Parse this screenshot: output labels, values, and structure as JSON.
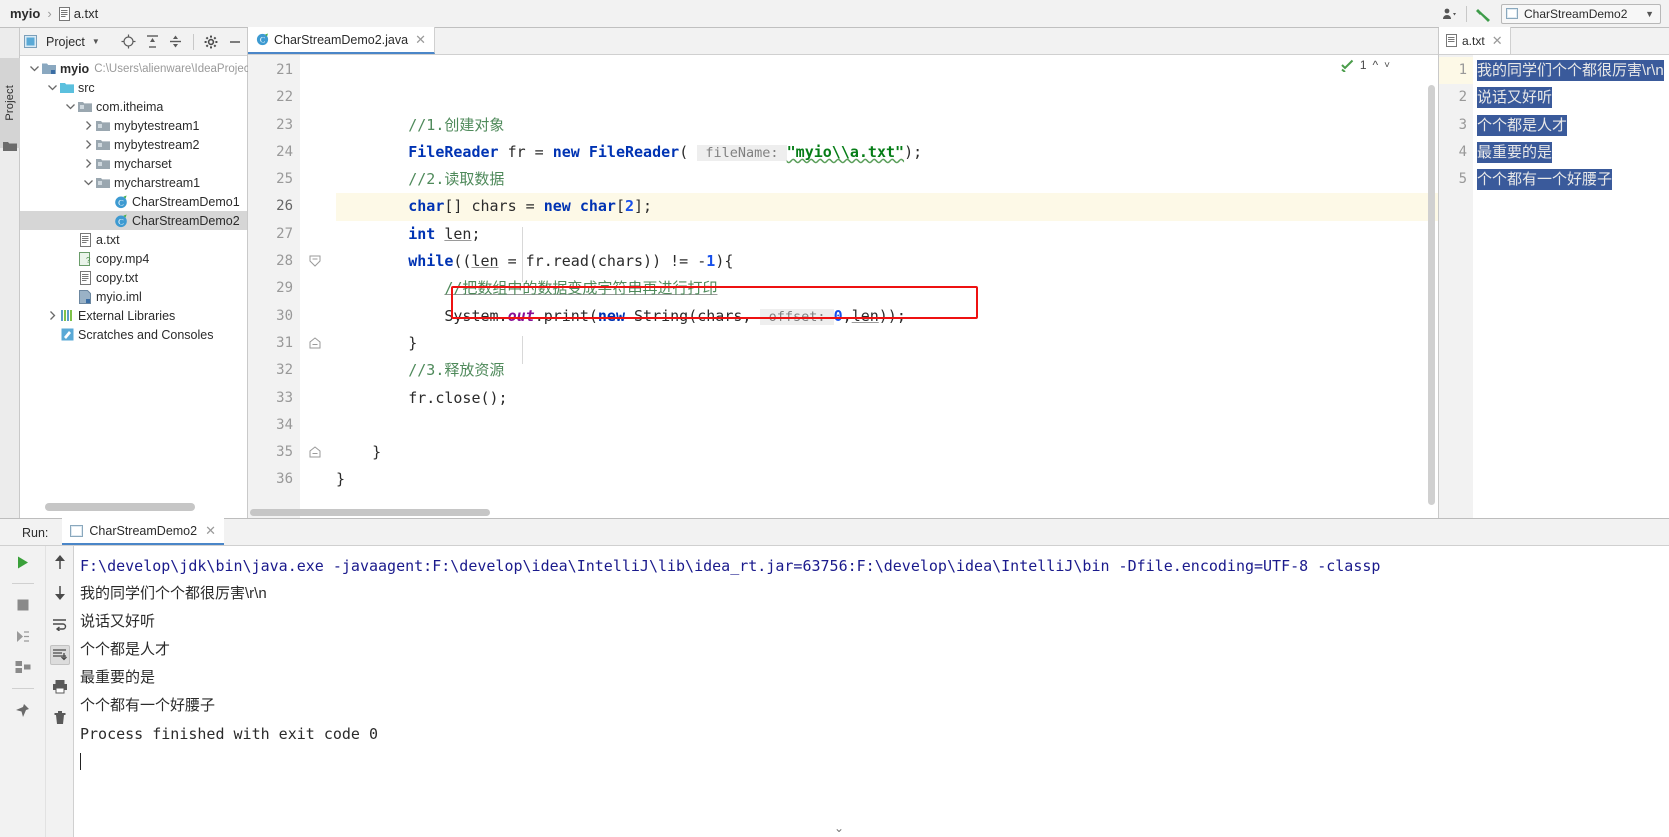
{
  "navbar": {
    "crumb_project": "myio",
    "crumb_sep": "›",
    "crumb_file": "a.txt",
    "file_icon": "text-file-icon",
    "user_icon": "user-settings-icon",
    "chevron_icon": "chevron-down-icon",
    "build_icon": "hammer-icon",
    "run_config_label": "CharStreamDemo2",
    "run_config_icon": "run-config-icon",
    "run_config_chevron": "chevron-down-icon"
  },
  "left_strip": {
    "project_label": "Project",
    "structure_icon": "folder-icon"
  },
  "project_panel": {
    "title": "Project",
    "title_icon": "project-view-icon",
    "title_chevron": "chevron-down-icon",
    "toolbar": [
      {
        "name": "locate-icon",
        "glyph": "target"
      },
      {
        "name": "expand-all-icon",
        "glyph": "expand"
      },
      {
        "name": "collapse-all-icon",
        "glyph": "collapse"
      },
      {
        "name": "settings-gear-icon",
        "glyph": "gear"
      },
      {
        "name": "hide-panel-icon",
        "glyph": "minus"
      }
    ],
    "tree": [
      {
        "label": "myio",
        "suffix": "C:\\Users\\alienware\\IdeaProjec",
        "icon": "module-icon",
        "arrow": "expanded",
        "indent": 0,
        "bold": true,
        "selected": false
      },
      {
        "label": "src",
        "suffix": "",
        "icon": "source-folder-icon",
        "arrow": "expanded",
        "indent": 1,
        "bold": false,
        "selected": false
      },
      {
        "label": "com.itheima",
        "suffix": "",
        "icon": "package-icon",
        "arrow": "expanded",
        "indent": 2,
        "bold": false,
        "selected": false
      },
      {
        "label": "mybytestream1",
        "suffix": "",
        "icon": "package-icon",
        "arrow": "collapsed",
        "indent": 3,
        "bold": false,
        "selected": false
      },
      {
        "label": "mybytestream2",
        "suffix": "",
        "icon": "package-icon",
        "arrow": "collapsed",
        "indent": 3,
        "bold": false,
        "selected": false
      },
      {
        "label": "mycharset",
        "suffix": "",
        "icon": "package-icon",
        "arrow": "collapsed",
        "indent": 3,
        "bold": false,
        "selected": false
      },
      {
        "label": "mycharstream1",
        "suffix": "",
        "icon": "package-icon",
        "arrow": "expanded",
        "indent": 3,
        "bold": false,
        "selected": false
      },
      {
        "label": "CharStreamDemo1",
        "suffix": "",
        "icon": "java-class-icon",
        "arrow": "none",
        "indent": 4,
        "bold": false,
        "selected": false
      },
      {
        "label": "CharStreamDemo2",
        "suffix": "",
        "icon": "java-class-icon",
        "arrow": "none",
        "indent": 4,
        "bold": false,
        "selected": true
      },
      {
        "label": "a.txt",
        "suffix": "",
        "icon": "text-file-icon",
        "arrow": "none",
        "indent": 2,
        "bold": false,
        "selected": false
      },
      {
        "label": "copy.mp4",
        "suffix": "",
        "icon": "media-file-icon",
        "arrow": "none",
        "indent": 2,
        "bold": false,
        "selected": false
      },
      {
        "label": "copy.txt",
        "suffix": "",
        "icon": "text-file-icon",
        "arrow": "none",
        "indent": 2,
        "bold": false,
        "selected": false
      },
      {
        "label": "myio.iml",
        "suffix": "",
        "icon": "iml-file-icon",
        "arrow": "none",
        "indent": 2,
        "bold": false,
        "selected": false
      },
      {
        "label": "External Libraries",
        "suffix": "",
        "icon": "libraries-icon",
        "arrow": "collapsed",
        "indent": 1,
        "bold": false,
        "selected": false
      },
      {
        "label": "Scratches and Consoles",
        "suffix": "",
        "icon": "scratches-icon",
        "arrow": "none",
        "indent": 1,
        "bold": false,
        "selected": false
      }
    ]
  },
  "editor": {
    "tab_label": "CharStreamDemo2.java",
    "tab_icon": "java-class-icon",
    "tab_close_icon": "close-icon",
    "inspection_count": "1",
    "inspection_icon": "inspection-ok-icon",
    "prev_icon": "chevron-up-icon",
    "next_icon": "chevron-down-icon",
    "first_line_number": 21,
    "lines": [
      {
        "n": 21,
        "html": "",
        "hl": false,
        "fold": "none"
      },
      {
        "n": 22,
        "html": "",
        "hl": false,
        "fold": "none"
      },
      {
        "n": 23,
        "html": "        <span class='cm'>//1.创建对象</span>",
        "hl": false,
        "fold": "none"
      },
      {
        "n": 24,
        "html": "        <span class='kw'>FileReader</span> fr = <span class='kw'>new</span> <span class='kw'>FileReader</span>( <span class='hint'> fileName: </span><span class='str wavy'>\"myio\\\\a.txt\"</span>);",
        "hl": false,
        "fold": "none"
      },
      {
        "n": 25,
        "html": "        <span class='cm'>//2.读取数据</span>",
        "hl": false,
        "fold": "none"
      },
      {
        "n": 26,
        "html": "        <span class='kw'>char</span>[] chars = <span class='kw'>new</span> <span class='kw'>char</span>[<span class='num'>2</span>];",
        "hl": true,
        "fold": "none"
      },
      {
        "n": 27,
        "html": "        <span class='kw'>int</span> <span class='und'>len</span>;",
        "hl": false,
        "fold": "none"
      },
      {
        "n": 28,
        "html": "        <span class='kw'>while</span>((<span class='und'>len</span> = fr.read(chars)) != -<span class='num'>1</span>){",
        "hl": false,
        "fold": "open"
      },
      {
        "n": 29,
        "html": "            <span class='cm und'>//把数组中的数据变成字符串再进行打印</span>",
        "hl": false,
        "fold": "none"
      },
      {
        "n": 30,
        "html": "            System.<span class='fld'>out</span>.print(<span class='kw'>new</span> String(chars, <span class='hint'> offset: </span><span class='num'>0</span>,<span class='und'>len</span>));",
        "hl": false,
        "fold": "none"
      },
      {
        "n": 31,
        "html": "        }",
        "hl": false,
        "fold": "close"
      },
      {
        "n": 32,
        "html": "        <span class='cm'>//3.释放资源</span>",
        "hl": false,
        "fold": "none"
      },
      {
        "n": 33,
        "html": "        fr.close();",
        "hl": false,
        "fold": "none"
      },
      {
        "n": 34,
        "html": "",
        "hl": false,
        "fold": "none"
      },
      {
        "n": 35,
        "html": "    }",
        "hl": false,
        "fold": "close"
      },
      {
        "n": 36,
        "html": "}",
        "hl": false,
        "fold": "none"
      }
    ]
  },
  "right_panel": {
    "tab_label": "a.txt",
    "tab_icon": "text-file-icon",
    "tab_close_icon": "close-icon",
    "lines": [
      {
        "n": 1,
        "text": "我的同学们个个都很厉害\\r\\n",
        "cur": true
      },
      {
        "n": 2,
        "text": "说话又好听",
        "cur": false
      },
      {
        "n": 3,
        "text": "个个都是人才",
        "cur": false
      },
      {
        "n": 4,
        "text": "最重要的是",
        "cur": false
      },
      {
        "n": 5,
        "text": "个个都有一个好腰子",
        "cur": false
      }
    ]
  },
  "run_panel": {
    "run_label": "Run:",
    "tab_label": "CharStreamDemo2",
    "tab_icon": "run-config-icon",
    "tab_close_icon": "close-icon",
    "toolbar_left": [
      {
        "name": "rerun-button",
        "glyph": "play"
      },
      {
        "name": "stop-button",
        "glyph": "stop"
      },
      {
        "name": "resume-program-button",
        "glyph": "resume"
      },
      {
        "name": "thread-dump-button",
        "glyph": "dump"
      },
      {
        "name": "pin-tab-button",
        "glyph": "pin"
      }
    ],
    "toolbar_right": [
      {
        "name": "up-the-stack-trace-button",
        "glyph": "arrow-up"
      },
      {
        "name": "down-the-stack-trace-button",
        "glyph": "arrow-down"
      },
      {
        "name": "soft-wrap-button",
        "glyph": "wrap"
      },
      {
        "name": "scroll-to-end-button",
        "glyph": "scroll-end",
        "active": true
      },
      {
        "name": "print-button",
        "glyph": "print"
      },
      {
        "name": "clear-all-button",
        "glyph": "trash"
      }
    ],
    "console_lines": [
      {
        "text": "F:\\develop\\jdk\\bin\\java.exe -javaagent:F:\\develop\\idea\\IntelliJ\\lib\\idea_rt.jar=63756:F:\\develop\\idea\\IntelliJ\\bin -Dfile.encoding=UTF-8 -classp",
        "kind": "cmd"
      },
      {
        "text": "我的同学们个个都很厉害\\r\\n",
        "kind": "cn"
      },
      {
        "text": "说话又好听",
        "kind": "cn"
      },
      {
        "text": "个个都是人才",
        "kind": "cn"
      },
      {
        "text": "最重要的是",
        "kind": "cn"
      },
      {
        "text": "个个都有一个好腰子",
        "kind": "cn"
      },
      {
        "text": "Process finished with exit code 0",
        "kind": "out"
      }
    ]
  },
  "colors": {
    "accent": "#4a86c8",
    "selection": "#3a5a9b",
    "highlight_line": "#fdf9e7",
    "red_box": "#ee1111",
    "keyword": "#0033b3",
    "string": "#067d17",
    "comment": "#4f8a5b",
    "number": "#1750eb",
    "field": "#871094"
  }
}
